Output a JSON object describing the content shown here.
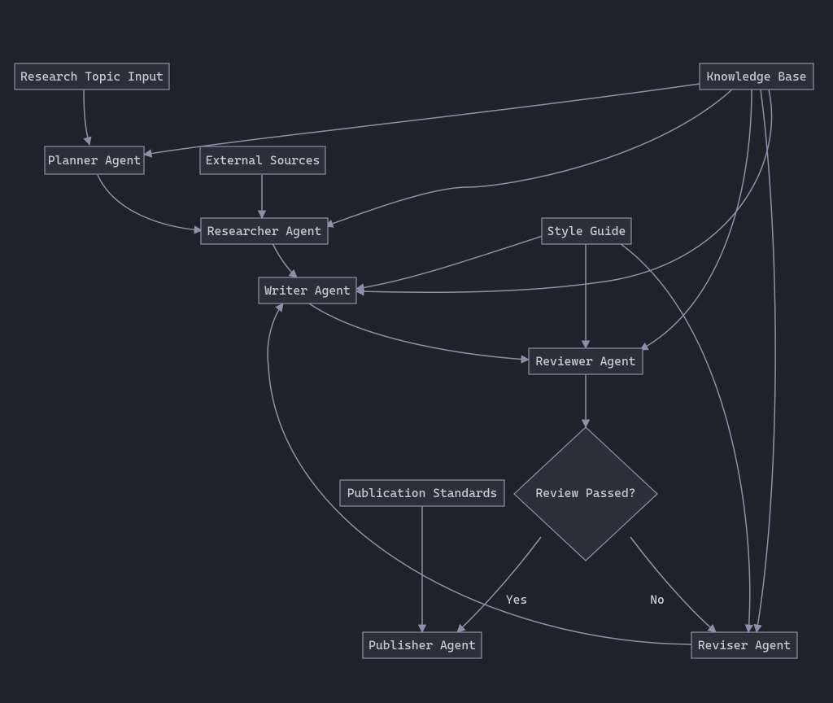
{
  "nodes": {
    "research_topic": "Research Topic Input",
    "planner": "Planner Agent",
    "external_sources": "External Sources",
    "knowledge_base": "Knowledge Base",
    "researcher": "Researcher Agent",
    "style_guide": "Style Guide",
    "writer": "Writer Agent",
    "reviewer": "Reviewer Agent",
    "review_passed": "Review Passed?",
    "publication_standards": "Publication Standards",
    "publisher": "Publisher Agent",
    "reviser": "Reviser Agent"
  },
  "edge_labels": {
    "yes": "Yes",
    "no": "No"
  }
}
